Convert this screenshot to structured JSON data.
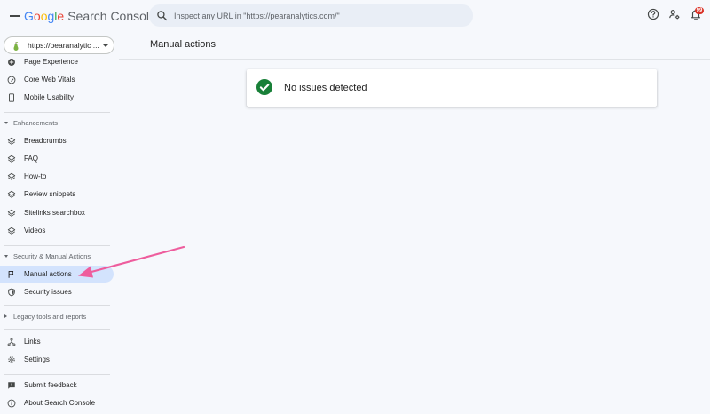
{
  "app": {
    "logo_parts": [
      "G",
      "o",
      "o",
      "g",
      "l",
      "e"
    ],
    "product": "Search Console",
    "search_placeholder": "Inspect any URL in \"https://pearanalytics.com/\""
  },
  "topbar": {
    "icons": [
      "help-icon",
      "manage-users-icon",
      "notifications-icon"
    ],
    "notification_count": "99"
  },
  "property": {
    "label": "https://pearanalytic ..."
  },
  "sidebar": {
    "items_top": [
      {
        "label": "Page Experience",
        "icon": "page-experience-icon"
      },
      {
        "label": "Core Web Vitals",
        "icon": "speed-icon"
      },
      {
        "label": "Mobile Usability",
        "icon": "phone-icon"
      }
    ],
    "enhancements": {
      "title": "Enhancements",
      "items": [
        {
          "label": "Breadcrumbs",
          "icon": "layers-icon"
        },
        {
          "label": "FAQ",
          "icon": "layers-icon"
        },
        {
          "label": "How-to",
          "icon": "layers-icon"
        },
        {
          "label": "Review snippets",
          "icon": "layers-icon"
        },
        {
          "label": "Sitelinks searchbox",
          "icon": "layers-icon"
        },
        {
          "label": "Videos",
          "icon": "layers-icon"
        }
      ]
    },
    "security": {
      "title": "Security & Manual Actions",
      "items": [
        {
          "label": "Manual actions",
          "icon": "flag-icon",
          "active": true
        },
        {
          "label": "Security issues",
          "icon": "shield-icon"
        }
      ]
    },
    "legacy": {
      "title": "Legacy tools and reports"
    },
    "items_bottom": [
      {
        "label": "Links",
        "icon": "links-icon"
      },
      {
        "label": "Settings",
        "icon": "gear-icon"
      }
    ],
    "items_footer": [
      {
        "label": "Submit feedback",
        "icon": "feedback-icon"
      },
      {
        "label": "About Search Console",
        "icon": "info-icon"
      }
    ]
  },
  "main": {
    "title": "Manual actions",
    "status_message": "No issues detected",
    "status_icon": "check-circle-icon"
  },
  "colors": {
    "accent": "#1a73e8",
    "active_bg": "#d3e3fd",
    "success": "#188038",
    "annotation_arrow": "#ee5d9d",
    "badge": "#d93025"
  }
}
